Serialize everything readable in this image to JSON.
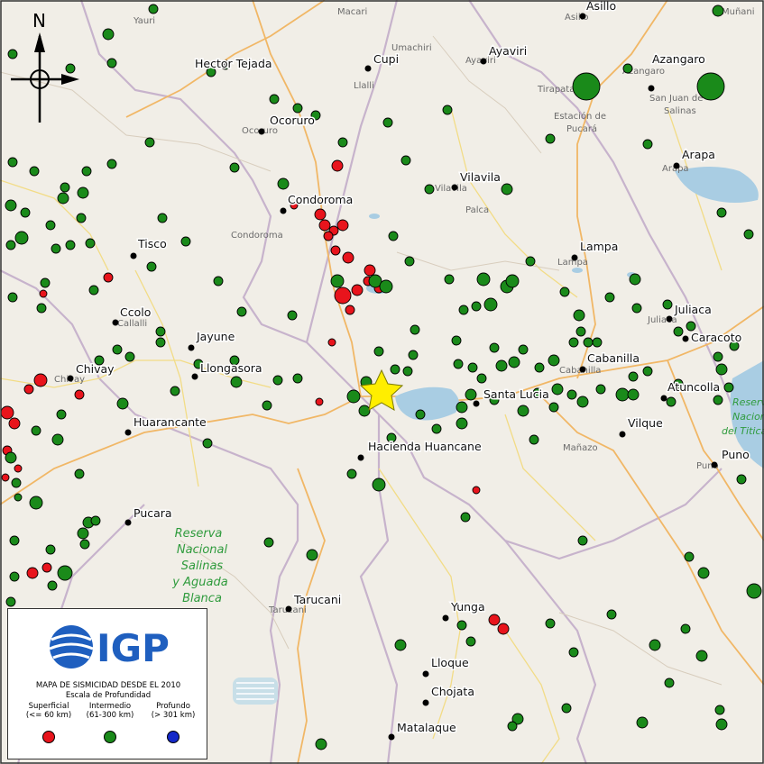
{
  "map": {
    "north_label": "N",
    "reserve_label": [
      "Reserva",
      "Nacional",
      "Salinas",
      "y Aguada",
      "Blanca"
    ],
    "reserve_titicaca_label": [
      "Reserva",
      "Nacional",
      "del Titicaca"
    ],
    "places_major": [
      "Cupi",
      "Ayaviri",
      "Azangaro",
      "Arapa",
      "Ocoruro",
      "Condoroma",
      "Vilavila",
      "Lampa",
      "Tisco",
      "Ccolo",
      "Jayune",
      "Llongasora",
      "Chivay",
      "Huarancante",
      "Hacienda Huancane",
      "Santa Lucia",
      "Cabanilla",
      "Juliaca",
      "Caracoto",
      "Atuncolla",
      "Vilque",
      "Puno",
      "Pucara",
      "Tarucani",
      "Yunga",
      "Lloque",
      "Chojata",
      "Matalaque",
      "Asillo",
      "Hector Tejada"
    ],
    "places_minor": [
      "Yauri",
      "Macari",
      "Umachiri",
      "Llalli",
      "Muñani",
      "Tirapata",
      "Estación de",
      "Pucará",
      "San Juan de",
      "Salinas",
      "Palca",
      "Callalli",
      "Chivay",
      "Cabanilla",
      "Mañazo",
      "Tarucani",
      "Lampa",
      "Juliaca",
      "Arapa",
      "Vilavila",
      "Ayaviri",
      "Ocoruro",
      "Condoroma",
      "Asillo",
      "Azangaro",
      "Puno"
    ]
  },
  "legend": {
    "logo_text": "IGP",
    "title": "MAPA DE SISMICIDAD DESDE EL 2010",
    "subtitle": "Escala de Profundidad",
    "categories": [
      {
        "name": "Superficial",
        "range": "(<= 60 km)",
        "color": "#e8141c"
      },
      {
        "name": "Intermedio",
        "range": "(61-300 km)",
        "color": "#1a8a1a"
      },
      {
        "name": "Profundo",
        "range": "(> 301 km)",
        "color": "#1428c8"
      }
    ]
  },
  "colors": {
    "land": "#f1eee7",
    "water": "#a9cde3",
    "road_orange": "#f1b766",
    "road_yellow": "#f6e27a",
    "boundary": "#b9a0c0",
    "star": "#ffee00"
  }
}
